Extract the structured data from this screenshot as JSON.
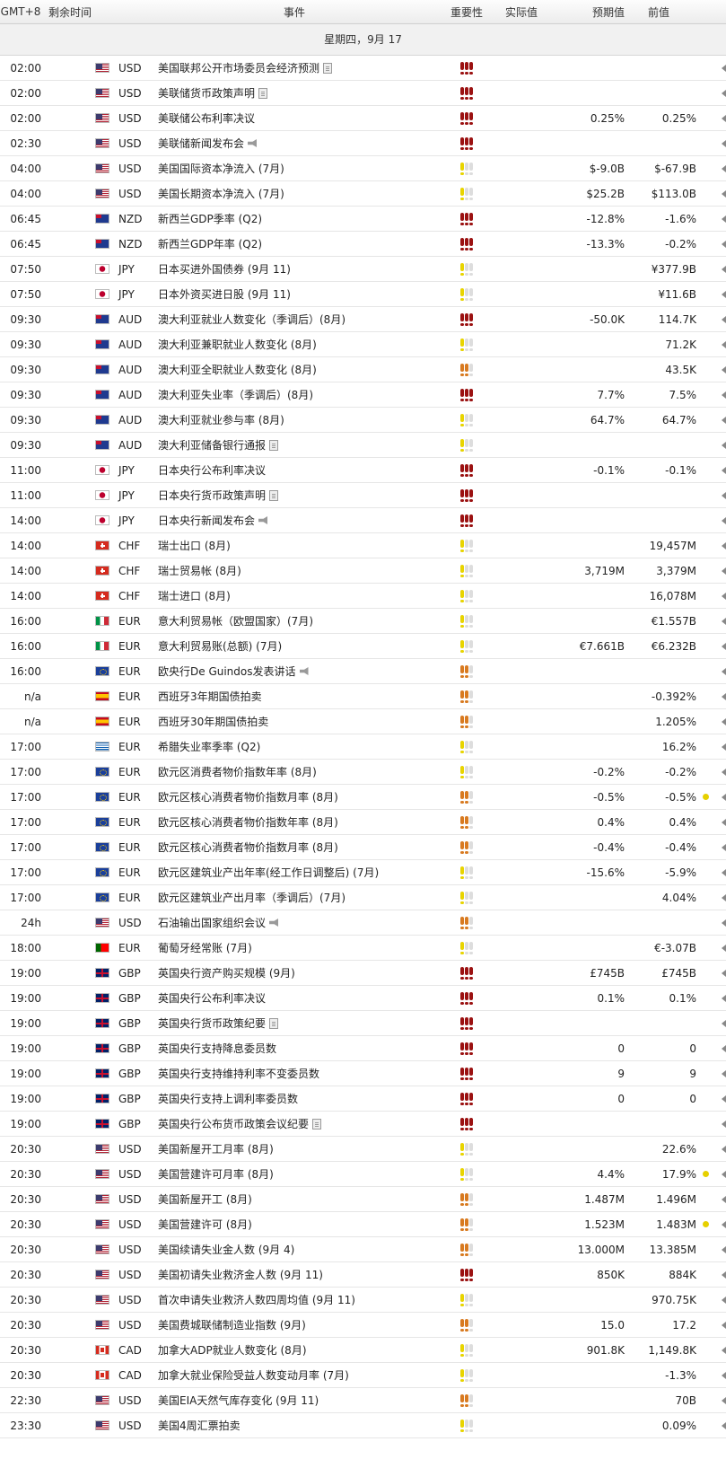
{
  "header": {
    "timezone": "GMT+8",
    "remaining": "剩余时间",
    "event": "事件",
    "importance": "重要性",
    "actual": "实际值",
    "forecast": "预期值",
    "previous": "前值"
  },
  "date_label": "星期四，9月 17",
  "colors": {
    "high": "#9b1111",
    "medium": "#d87a20",
    "low": "#e8d400",
    "off": "#dddddd"
  },
  "rows": [
    {
      "time": "02:00",
      "cur": "USD",
      "flag": "us",
      "event": "美国联邦公开市场委员会经济预测",
      "icon": "doc",
      "imp": 3,
      "actual": "",
      "forecast": "",
      "previous": "",
      "dot": false
    },
    {
      "time": "02:00",
      "cur": "USD",
      "flag": "us",
      "event": "美联储货币政策声明",
      "icon": "doc",
      "imp": 3,
      "actual": "",
      "forecast": "",
      "previous": "",
      "dot": false
    },
    {
      "time": "02:00",
      "cur": "USD",
      "flag": "us",
      "event": "美联储公布利率决议",
      "icon": "",
      "imp": 3,
      "actual": "",
      "forecast": "0.25%",
      "previous": "0.25%",
      "dot": false
    },
    {
      "time": "02:30",
      "cur": "USD",
      "flag": "us",
      "event": "美联储新闻发布会",
      "icon": "speech",
      "imp": 3,
      "actual": "",
      "forecast": "",
      "previous": "",
      "dot": false
    },
    {
      "time": "04:00",
      "cur": "USD",
      "flag": "us",
      "event": "美国国际资本净流入 (7月)",
      "icon": "",
      "imp": 1,
      "actual": "",
      "forecast": "$-9.0B",
      "previous": "$-67.9B",
      "dot": false
    },
    {
      "time": "04:00",
      "cur": "USD",
      "flag": "us",
      "event": "美国长期资本净流入 (7月)",
      "icon": "",
      "imp": 1,
      "actual": "",
      "forecast": "$25.2B",
      "previous": "$113.0B",
      "dot": false
    },
    {
      "time": "06:45",
      "cur": "NZD",
      "flag": "nz",
      "event": "新西兰GDP季率 (Q2)",
      "icon": "",
      "imp": 3,
      "actual": "",
      "forecast": "-12.8%",
      "previous": "-1.6%",
      "dot": false
    },
    {
      "time": "06:45",
      "cur": "NZD",
      "flag": "nz",
      "event": "新西兰GDP年率 (Q2)",
      "icon": "",
      "imp": 3,
      "actual": "",
      "forecast": "-13.3%",
      "previous": "-0.2%",
      "dot": false
    },
    {
      "time": "07:50",
      "cur": "JPY",
      "flag": "jp",
      "event": "日本买进外国债券 (9月 11)",
      "icon": "",
      "imp": 1,
      "actual": "",
      "forecast": "",
      "previous": "¥377.9B",
      "dot": false
    },
    {
      "time": "07:50",
      "cur": "JPY",
      "flag": "jp",
      "event": "日本外资买进日股 (9月 11)",
      "icon": "",
      "imp": 1,
      "actual": "",
      "forecast": "",
      "previous": "¥11.6B",
      "dot": false
    },
    {
      "time": "09:30",
      "cur": "AUD",
      "flag": "au",
      "event": "澳大利亚就业人数变化（季调后）(8月)",
      "icon": "",
      "imp": 3,
      "actual": "",
      "forecast": "-50.0K",
      "previous": "114.7K",
      "dot": false
    },
    {
      "time": "09:30",
      "cur": "AUD",
      "flag": "au",
      "event": "澳大利亚兼职就业人数变化 (8月)",
      "icon": "",
      "imp": 1,
      "actual": "",
      "forecast": "",
      "previous": "71.2K",
      "dot": false
    },
    {
      "time": "09:30",
      "cur": "AUD",
      "flag": "au",
      "event": "澳大利亚全职就业人数变化 (8月)",
      "icon": "",
      "imp": 2,
      "actual": "",
      "forecast": "",
      "previous": "43.5K",
      "dot": false
    },
    {
      "time": "09:30",
      "cur": "AUD",
      "flag": "au",
      "event": "澳大利亚失业率（季调后）(8月)",
      "icon": "",
      "imp": 3,
      "actual": "",
      "forecast": "7.7%",
      "previous": "7.5%",
      "dot": false
    },
    {
      "time": "09:30",
      "cur": "AUD",
      "flag": "au",
      "event": "澳大利亚就业参与率 (8月)",
      "icon": "",
      "imp": 1,
      "actual": "",
      "forecast": "64.7%",
      "previous": "64.7%",
      "dot": false
    },
    {
      "time": "09:30",
      "cur": "AUD",
      "flag": "au",
      "event": "澳大利亚储备银行通报",
      "icon": "doc",
      "imp": 1,
      "actual": "",
      "forecast": "",
      "previous": "",
      "dot": false
    },
    {
      "time": "11:00",
      "cur": "JPY",
      "flag": "jp",
      "event": "日本央行公布利率决议",
      "icon": "",
      "imp": 3,
      "actual": "",
      "forecast": "-0.1%",
      "previous": "-0.1%",
      "dot": false
    },
    {
      "time": "11:00",
      "cur": "JPY",
      "flag": "jp",
      "event": "日本央行货币政策声明",
      "icon": "doc",
      "imp": 3,
      "actual": "",
      "forecast": "",
      "previous": "",
      "dot": false
    },
    {
      "time": "14:00",
      "cur": "JPY",
      "flag": "jp",
      "event": "日本央行新闻发布会",
      "icon": "speech",
      "imp": 3,
      "actual": "",
      "forecast": "",
      "previous": "",
      "dot": false
    },
    {
      "time": "14:00",
      "cur": "CHF",
      "flag": "ch",
      "event": "瑞士出口 (8月)",
      "icon": "",
      "imp": 1,
      "actual": "",
      "forecast": "",
      "previous": "19,457M",
      "dot": false
    },
    {
      "time": "14:00",
      "cur": "CHF",
      "flag": "ch",
      "event": "瑞士贸易帐 (8月)",
      "icon": "",
      "imp": 1,
      "actual": "",
      "forecast": "3,719M",
      "previous": "3,379M",
      "dot": false
    },
    {
      "time": "14:00",
      "cur": "CHF",
      "flag": "ch",
      "event": "瑞士进口 (8月)",
      "icon": "",
      "imp": 1,
      "actual": "",
      "forecast": "",
      "previous": "16,078M",
      "dot": false
    },
    {
      "time": "16:00",
      "cur": "EUR",
      "flag": "it",
      "event": "意大利贸易帐（欧盟国家）(7月)",
      "icon": "",
      "imp": 1,
      "actual": "",
      "forecast": "",
      "previous": "€1.557B",
      "dot": false
    },
    {
      "time": "16:00",
      "cur": "EUR",
      "flag": "it",
      "event": "意大利贸易账(总额) (7月)",
      "icon": "",
      "imp": 1,
      "actual": "",
      "forecast": "€7.661B",
      "previous": "€6.232B",
      "dot": false
    },
    {
      "time": "16:00",
      "cur": "EUR",
      "flag": "eu",
      "event": "欧央行De Guindos发表讲话",
      "icon": "speech",
      "imp": 2,
      "actual": "",
      "forecast": "",
      "previous": "",
      "dot": false
    },
    {
      "time": "n/a",
      "cur": "EUR",
      "flag": "es",
      "event": "西班牙3年期国债拍卖",
      "icon": "",
      "imp": 2,
      "actual": "",
      "forecast": "",
      "previous": "-0.392%",
      "dot": false
    },
    {
      "time": "n/a",
      "cur": "EUR",
      "flag": "es",
      "event": "西班牙30年期国债拍卖",
      "icon": "",
      "imp": 2,
      "actual": "",
      "forecast": "",
      "previous": "1.205%",
      "dot": false
    },
    {
      "time": "17:00",
      "cur": "EUR",
      "flag": "gr",
      "event": "希腊失业率季率 (Q2)",
      "icon": "",
      "imp": 1,
      "actual": "",
      "forecast": "",
      "previous": "16.2%",
      "dot": false
    },
    {
      "time": "17:00",
      "cur": "EUR",
      "flag": "eu",
      "event": "欧元区消费者物价指数年率 (8月)",
      "icon": "",
      "imp": 1,
      "actual": "",
      "forecast": "-0.2%",
      "previous": "-0.2%",
      "dot": false
    },
    {
      "time": "17:00",
      "cur": "EUR",
      "flag": "eu",
      "event": "欧元区核心消费者物价指数月率 (8月)",
      "icon": "",
      "imp": 2,
      "actual": "",
      "forecast": "-0.5%",
      "previous": "-0.5%",
      "dot": true
    },
    {
      "time": "17:00",
      "cur": "EUR",
      "flag": "eu",
      "event": "欧元区核心消费者物价指数年率 (8月)",
      "icon": "",
      "imp": 2,
      "actual": "",
      "forecast": "0.4%",
      "previous": "0.4%",
      "dot": false
    },
    {
      "time": "17:00",
      "cur": "EUR",
      "flag": "eu",
      "event": "欧元区核心消费者物价指数月率 (8月)",
      "icon": "",
      "imp": 2,
      "actual": "",
      "forecast": "-0.4%",
      "previous": "-0.4%",
      "dot": false
    },
    {
      "time": "17:00",
      "cur": "EUR",
      "flag": "eu",
      "event": "欧元区建筑业产出年率(经工作日调整后) (7月)",
      "icon": "",
      "imp": 1,
      "actual": "",
      "forecast": "-15.6%",
      "previous": "-5.9%",
      "dot": false
    },
    {
      "time": "17:00",
      "cur": "EUR",
      "flag": "eu",
      "event": "欧元区建筑业产出月率（季调后）(7月)",
      "icon": "",
      "imp": 1,
      "actual": "",
      "forecast": "",
      "previous": "4.04%",
      "dot": false
    },
    {
      "time": "24h",
      "cur": "USD",
      "flag": "us",
      "event": "石油输出国家组织会议",
      "icon": "speech",
      "imp": 2,
      "actual": "",
      "forecast": "",
      "previous": "",
      "dot": false
    },
    {
      "time": "18:00",
      "cur": "EUR",
      "flag": "pt",
      "event": "葡萄牙经常账 (7月)",
      "icon": "",
      "imp": 1,
      "actual": "",
      "forecast": "",
      "previous": "€-3.07B",
      "dot": false
    },
    {
      "time": "19:00",
      "cur": "GBP",
      "flag": "gb",
      "event": "英国央行资产购买规模 (9月)",
      "icon": "",
      "imp": 3,
      "actual": "",
      "forecast": "£745B",
      "previous": "£745B",
      "dot": false
    },
    {
      "time": "19:00",
      "cur": "GBP",
      "flag": "gb",
      "event": "英国央行公布利率决议",
      "icon": "",
      "imp": 3,
      "actual": "",
      "forecast": "0.1%",
      "previous": "0.1%",
      "dot": false
    },
    {
      "time": "19:00",
      "cur": "GBP",
      "flag": "gb",
      "event": "英国央行货币政策纪要",
      "icon": "doc",
      "imp": 3,
      "actual": "",
      "forecast": "",
      "previous": "",
      "dot": false
    },
    {
      "time": "19:00",
      "cur": "GBP",
      "flag": "gb",
      "event": "英国央行支持降息委员数",
      "icon": "",
      "imp": 3,
      "actual": "",
      "forecast": "0",
      "previous": "0",
      "dot": false
    },
    {
      "time": "19:00",
      "cur": "GBP",
      "flag": "gb",
      "event": "英国央行支持维持利率不变委员数",
      "icon": "",
      "imp": 3,
      "actual": "",
      "forecast": "9",
      "previous": "9",
      "dot": false
    },
    {
      "time": "19:00",
      "cur": "GBP",
      "flag": "gb",
      "event": "英国央行支持上调利率委员数",
      "icon": "",
      "imp": 3,
      "actual": "",
      "forecast": "0",
      "previous": "0",
      "dot": false
    },
    {
      "time": "19:00",
      "cur": "GBP",
      "flag": "gb",
      "event": "英国央行公布货币政策会议纪要",
      "icon": "doc",
      "imp": 3,
      "actual": "",
      "forecast": "",
      "previous": "",
      "dot": false
    },
    {
      "time": "20:30",
      "cur": "USD",
      "flag": "us",
      "event": "美国新屋开工月率 (8月)",
      "icon": "",
      "imp": 1,
      "actual": "",
      "forecast": "",
      "previous": "22.6%",
      "dot": false
    },
    {
      "time": "20:30",
      "cur": "USD",
      "flag": "us",
      "event": "美国营建许可月率 (8月)",
      "icon": "",
      "imp": 1,
      "actual": "",
      "forecast": "4.4%",
      "previous": "17.9%",
      "dot": true
    },
    {
      "time": "20:30",
      "cur": "USD",
      "flag": "us",
      "event": "美国新屋开工 (8月)",
      "icon": "",
      "imp": 2,
      "actual": "",
      "forecast": "1.487M",
      "previous": "1.496M",
      "dot": false
    },
    {
      "time": "20:30",
      "cur": "USD",
      "flag": "us",
      "event": "美国营建许可 (8月)",
      "icon": "",
      "imp": 2,
      "actual": "",
      "forecast": "1.523M",
      "previous": "1.483M",
      "dot": true
    },
    {
      "time": "20:30",
      "cur": "USD",
      "flag": "us",
      "event": "美国续请失业金人数 (9月 4)",
      "icon": "",
      "imp": 2,
      "actual": "",
      "forecast": "13.000M",
      "previous": "13.385M",
      "dot": false
    },
    {
      "time": "20:30",
      "cur": "USD",
      "flag": "us",
      "event": "美国初请失业救济金人数 (9月 11)",
      "icon": "",
      "imp": 3,
      "actual": "",
      "forecast": "850K",
      "previous": "884K",
      "dot": false
    },
    {
      "time": "20:30",
      "cur": "USD",
      "flag": "us",
      "event": "首次申请失业救济人数四周均值 (9月 11)",
      "icon": "",
      "imp": 1,
      "actual": "",
      "forecast": "",
      "previous": "970.75K",
      "dot": false
    },
    {
      "time": "20:30",
      "cur": "USD",
      "flag": "us",
      "event": "美国费城联储制造业指数 (9月)",
      "icon": "",
      "imp": 2,
      "actual": "",
      "forecast": "15.0",
      "previous": "17.2",
      "dot": false
    },
    {
      "time": "20:30",
      "cur": "CAD",
      "flag": "ca",
      "event": "加拿大ADP就业人数变化 (8月)",
      "icon": "",
      "imp": 1,
      "actual": "",
      "forecast": "901.8K",
      "previous": "1,149.8K",
      "dot": false
    },
    {
      "time": "20:30",
      "cur": "CAD",
      "flag": "ca",
      "event": "加拿大就业保险受益人数变动月率 (7月)",
      "icon": "",
      "imp": 1,
      "actual": "",
      "forecast": "",
      "previous": "-1.3%",
      "dot": false
    },
    {
      "time": "22:30",
      "cur": "USD",
      "flag": "us",
      "event": "美国EIA天然气库存变化 (9月 11)",
      "icon": "",
      "imp": 2,
      "actual": "",
      "forecast": "",
      "previous": "70B",
      "dot": false
    },
    {
      "time": "23:30",
      "cur": "USD",
      "flag": "us",
      "event": "美国4周汇票拍卖",
      "icon": "",
      "imp": 1,
      "actual": "",
      "forecast": "",
      "previous": "0.09%",
      "dot": false
    }
  ]
}
